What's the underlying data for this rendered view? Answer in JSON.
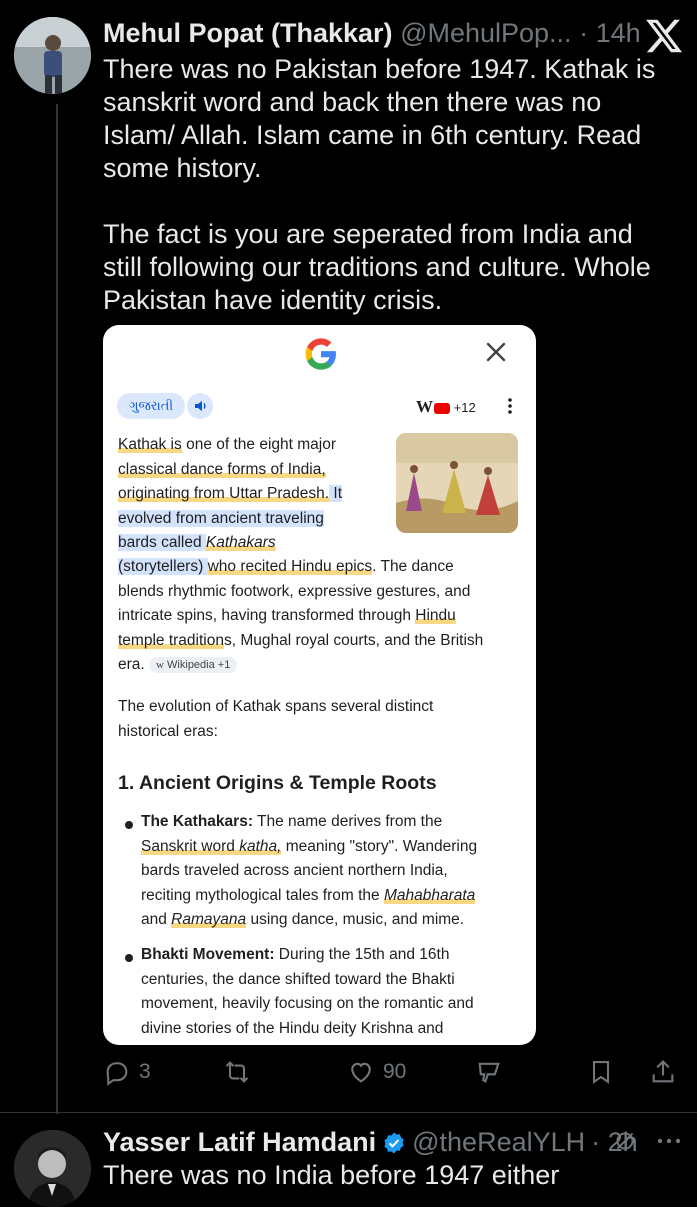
{
  "tweet": {
    "author_name": "Mehul Popat (Thakkar)",
    "handle": "@MehulPop...",
    "time": "· 14h",
    "text": "There was no Pakistan before 1947. Kathak is sanskrit word and back then there was no Islam/ Allah. Islam came in 6th century. Read some history.\n\nThe fact is you are seperated from India and still following our traditions and culture. Whole Pakistan have identity crisis."
  },
  "card": {
    "lang_chip": "ગુજરાતી",
    "sources_more": "+12",
    "intro": {
      "p1": "Kathak is",
      "p2": " one of the eight major",
      "p3": "classical dance forms of India,",
      "p4": "originating from Uttar Pradesh.",
      "p5": " It",
      "p6": "evolved from ancient traveling",
      "p7": "bards called ",
      "p8": "Kathakars",
      "p9": "(storytellers) ",
      "p10": "who recited Hindu epics",
      "p11": ". The dance",
      "p12": "blends rhythmic footwork, expressive gestures, and",
      "p13": "intricate spins, having transformed through ",
      "p14": "Hindu",
      "p15": "temple tradition",
      "p16": "s, Mughal royal courts, and the British",
      "p17": "era."
    },
    "citation": "Wikipedia +1",
    "evolution_text": "The evolution of Kathak spans several distinct historical eras:",
    "heading": "1. Ancient Origins & Temple Roots",
    "bullet1": {
      "title": "The Kathakars:",
      "t1": " The name derives from the",
      "t2": "Sanskrit word ",
      "t3": "katha,",
      "t4": " meaning \"story\". Wandering",
      "t5": "bards traveled across ancient northern India,",
      "t6": "reciting mythological tales from the ",
      "t7": "Mahabharata",
      "t8": "and ",
      "t9": "Ramayana",
      "t10": " using dance, music, and mime."
    },
    "bullet2": {
      "title": "Bhakti Movement:",
      "t1": " During the 15th and 16th",
      "t2": "centuries, the dance shifted toward the Bhakti",
      "t3": "movement, heavily focusing on the romantic and",
      "t4": "divine stories of the Hindu deity Krishna and"
    }
  },
  "actions": {
    "replies": "3",
    "reposts": "",
    "likes": "90"
  },
  "reply": {
    "author_name": "Yasser Latif Hamdani",
    "handle": "@theRealYLH",
    "time": "· 2h",
    "text": "There was no India before 1947 either"
  },
  "colors": {
    "background": "#000000",
    "text": "#e7e9ea",
    "muted": "#71767b",
    "verified": "#1d9bf0",
    "highlight_blue": "#d3e3fd"
  },
  "icons": [
    "x-logo-icon",
    "google-logo-icon",
    "close-icon",
    "speaker-icon",
    "more-vertical-icon",
    "reply-icon",
    "repost-icon",
    "like-icon",
    "grok-icon",
    "bookmark-icon",
    "share-icon",
    "verified-badge-icon",
    "mute-icon",
    "more-horizontal-icon"
  ]
}
